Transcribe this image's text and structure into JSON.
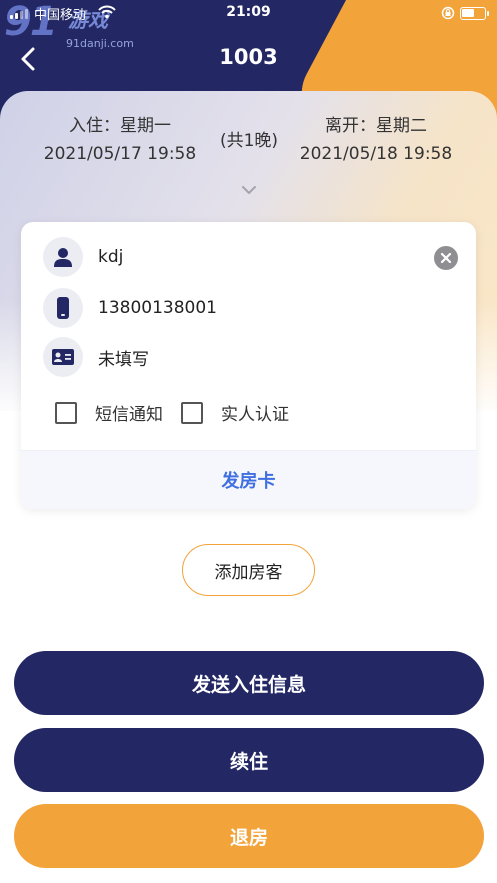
{
  "status_bar": {
    "carrier": "中国移动",
    "time": "21:09"
  },
  "watermark": {
    "logo": "91",
    "name": "游戏",
    "url": "91danji.com"
  },
  "header": {
    "title": "1003"
  },
  "stay": {
    "checkin_label": "入住：星期一",
    "checkin_datetime": "2021/05/17 19:58",
    "nights": "(共1晚)",
    "checkout_label": "离开：星期二",
    "checkout_datetime": "2021/05/18 19:58"
  },
  "guest_card": {
    "name": "kdj",
    "phone": "13800138001",
    "id_number": "未填写",
    "sms_notify_label": "短信通知",
    "sms_notify_checked": false,
    "realname_label": "实人认证",
    "realname_checked": false,
    "issue_card_label": "发房卡"
  },
  "add_guest_label": "添加房客",
  "actions": {
    "send_checkin_info": "发送入住信息",
    "extend_stay": "续住",
    "checkout": "退房"
  },
  "colors": {
    "navy": "#232864",
    "orange": "#f2a33a",
    "link_blue": "#3f6fe0"
  },
  "icons": [
    "back-arrow-icon",
    "chevron-down-icon",
    "user-icon",
    "phone-icon",
    "id-card-icon",
    "clear-icon",
    "wifi-icon",
    "lock-rotation-icon",
    "battery-icon"
  ]
}
